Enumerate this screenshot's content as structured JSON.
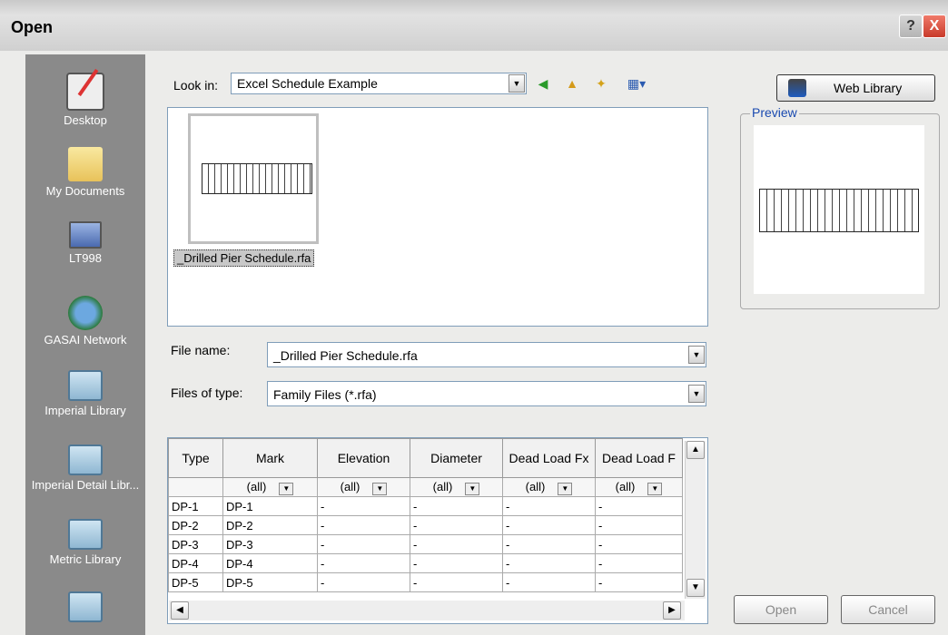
{
  "window": {
    "title": "Open",
    "help_label": "?",
    "close_label": "X"
  },
  "places": [
    {
      "label": "Desktop",
      "icon": "desktop-icon"
    },
    {
      "label": "My Documents",
      "icon": "my-documents-icon"
    },
    {
      "label": "LT998",
      "icon": "computer-icon"
    },
    {
      "label": "GASAI Network",
      "icon": "network-icon"
    },
    {
      "label": "Imperial Library",
      "icon": "folder-icon"
    },
    {
      "label": "Imperial Detail Libr...",
      "icon": "folder-icon"
    },
    {
      "label": "Metric Library",
      "icon": "folder-icon"
    }
  ],
  "lookin": {
    "label": "Look in:",
    "value": "Excel Schedule Example"
  },
  "toolbar": {
    "back_icon": "back-arrow-icon",
    "up_icon": "up-folder-icon",
    "newfolder_icon": "new-folder-icon",
    "views_icon": "views-icon"
  },
  "files": [
    {
      "name": "_Drilled Pier Schedule.rfa"
    }
  ],
  "web_library": {
    "label": "Web Library"
  },
  "preview": {
    "label": "Preview"
  },
  "filename": {
    "label": "File name:",
    "value": "_Drilled Pier Schedule.rfa"
  },
  "filetype": {
    "label": "Files of type:",
    "value": "Family Files (*.rfa)"
  },
  "grid": {
    "columns": [
      "Type",
      "Mark",
      "Elevation",
      "Diameter",
      "Dead Load Fx",
      "Dead Load F"
    ],
    "filters": [
      "",
      "(all)",
      "(all)",
      "(all)",
      "(all)",
      "(all)"
    ],
    "rows": [
      [
        "DP-1",
        "DP-1",
        "-",
        "-",
        "-",
        "-"
      ],
      [
        "DP-2",
        "DP-2",
        "-",
        "-",
        "-",
        "-"
      ],
      [
        "DP-3",
        "DP-3",
        "-",
        "-",
        "-",
        "-"
      ],
      [
        "DP-4",
        "DP-4",
        "-",
        "-",
        "-",
        "-"
      ],
      [
        "DP-5",
        "DP-5",
        "-",
        "-",
        "-",
        "-"
      ]
    ]
  },
  "buttons": {
    "open": "Open",
    "cancel": "Cancel"
  }
}
